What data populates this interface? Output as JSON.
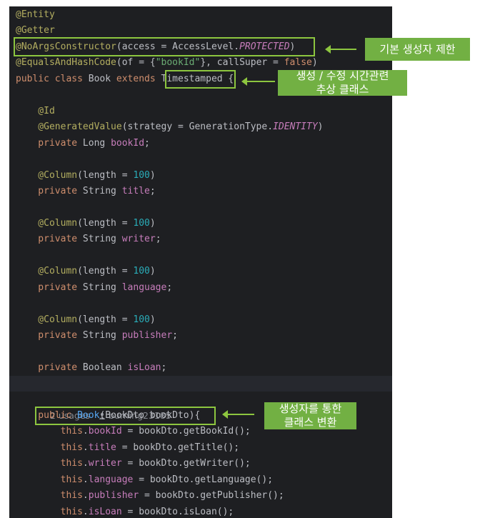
{
  "code_lines": [
    [
      {
        "t": "@Entity",
        "c": "ann"
      }
    ],
    [
      {
        "t": "@Getter",
        "c": "ann"
      }
    ],
    [
      {
        "t": "@NoArgsConstructor",
        "c": "ann"
      },
      {
        "t": "(access = AccessLevel.",
        "c": ""
      },
      {
        "t": "PROTECTED",
        "c": "cst"
      },
      {
        "t": ")",
        "c": ""
      }
    ],
    [
      {
        "t": "@EqualsAndHashCode",
        "c": "ann"
      },
      {
        "t": "(of = {",
        "c": ""
      },
      {
        "t": "\"bookId\"",
        "c": "str"
      },
      {
        "t": "}, callSuper = ",
        "c": ""
      },
      {
        "t": "false",
        "c": "kw"
      },
      {
        "t": ")",
        "c": ""
      }
    ],
    [
      {
        "t": "public class ",
        "c": "kw"
      },
      {
        "t": "Book ",
        "c": ""
      },
      {
        "t": "extends ",
        "c": "kw"
      },
      {
        "t": "Timestamped",
        "c": ""
      },
      {
        "t": " {",
        "c": ""
      }
    ],
    [],
    [
      {
        "t": "    @Id",
        "c": "ann"
      }
    ],
    [
      {
        "t": "    @GeneratedValue",
        "c": "ann"
      },
      {
        "t": "(strategy = GenerationType.",
        "c": ""
      },
      {
        "t": "IDENTITY",
        "c": "cst"
      },
      {
        "t": ")",
        "c": ""
      }
    ],
    [
      {
        "t": "    private ",
        "c": "kw"
      },
      {
        "t": "Long ",
        "c": ""
      },
      {
        "t": "bookId",
        "c": "fld"
      },
      {
        "t": ";",
        "c": ""
      }
    ],
    [],
    [
      {
        "t": "    @Column",
        "c": "ann"
      },
      {
        "t": "(length = ",
        "c": ""
      },
      {
        "t": "100",
        "c": "num"
      },
      {
        "t": ")",
        "c": ""
      }
    ],
    [
      {
        "t": "    private ",
        "c": "kw"
      },
      {
        "t": "String ",
        "c": ""
      },
      {
        "t": "title",
        "c": "fld"
      },
      {
        "t": ";",
        "c": ""
      }
    ],
    [],
    [
      {
        "t": "    @Column",
        "c": "ann"
      },
      {
        "t": "(length = ",
        "c": ""
      },
      {
        "t": "100",
        "c": "num"
      },
      {
        "t": ")",
        "c": ""
      }
    ],
    [
      {
        "t": "    private ",
        "c": "kw"
      },
      {
        "t": "String ",
        "c": ""
      },
      {
        "t": "writer",
        "c": "fld"
      },
      {
        "t": ";",
        "c": ""
      }
    ],
    [],
    [
      {
        "t": "    @Column",
        "c": "ann"
      },
      {
        "t": "(length = ",
        "c": ""
      },
      {
        "t": "100",
        "c": "num"
      },
      {
        "t": ")",
        "c": ""
      }
    ],
    [
      {
        "t": "    private ",
        "c": "kw"
      },
      {
        "t": "String ",
        "c": ""
      },
      {
        "t": "language",
        "c": "fld"
      },
      {
        "t": ";",
        "c": ""
      }
    ],
    [],
    [
      {
        "t": "    @Column",
        "c": "ann"
      },
      {
        "t": "(length = ",
        "c": ""
      },
      {
        "t": "100",
        "c": "num"
      },
      {
        "t": ")",
        "c": ""
      }
    ],
    [
      {
        "t": "    private ",
        "c": "kw"
      },
      {
        "t": "String ",
        "c": ""
      },
      {
        "t": "publisher",
        "c": "fld"
      },
      {
        "t": ";",
        "c": ""
      }
    ],
    [],
    [
      {
        "t": "    private ",
        "c": "kw"
      },
      {
        "t": "Boolean ",
        "c": ""
      },
      {
        "t": "isLoan",
        "c": "fld"
      },
      {
        "t": ";",
        "c": ""
      }
    ]
  ],
  "code_lines_2": [
    [
      {
        "t": "    public ",
        "c": "kw"
      },
      {
        "t": "Book",
        "c": "fn"
      },
      {
        "t": "(BookDto bookDto){",
        "c": ""
      }
    ],
    [
      {
        "t": "        this",
        "c": "kw"
      },
      {
        "t": ".",
        "c": ""
      },
      {
        "t": "bookId",
        "c": "fld"
      },
      {
        "t": " = bookDto.getBookId();",
        "c": ""
      }
    ],
    [
      {
        "t": "        this",
        "c": "kw"
      },
      {
        "t": ".",
        "c": ""
      },
      {
        "t": "title",
        "c": "fld"
      },
      {
        "t": " = bookDto.getTitle();",
        "c": ""
      }
    ],
    [
      {
        "t": "        this",
        "c": "kw"
      },
      {
        "t": ".",
        "c": ""
      },
      {
        "t": "writer",
        "c": "fld"
      },
      {
        "t": " = bookDto.getWriter();",
        "c": ""
      }
    ],
    [
      {
        "t": "        this",
        "c": "kw"
      },
      {
        "t": ".",
        "c": ""
      },
      {
        "t": "language",
        "c": "fld"
      },
      {
        "t": " = bookDto.getLanguage();",
        "c": ""
      }
    ],
    [
      {
        "t": "        this",
        "c": "kw"
      },
      {
        "t": ".",
        "c": ""
      },
      {
        "t": "publisher",
        "c": "fld"
      },
      {
        "t": " = bookDto.getPublisher();",
        "c": ""
      }
    ],
    [
      {
        "t": "        this",
        "c": "kw"
      },
      {
        "t": ".",
        "c": ""
      },
      {
        "t": "isLoan",
        "c": "fld"
      },
      {
        "t": " = bookDto.isLoan();",
        "c": ""
      }
    ]
  ],
  "usage_hint": {
    "usages": "2 usages",
    "author_icon": "person-icon",
    "author": "burning23185"
  },
  "annotations": {
    "noargs": "기본 생성자 제한",
    "timestamped_line1": "생성 / 수정 시간관련",
    "timestamped_line2": "추상 클래스",
    "constructor_line1": "생성자를 통한",
    "constructor_line2": "클래스 변환"
  },
  "colors": {
    "editor_bg": "#1e1f22",
    "annotation": "#b3ae60",
    "keyword": "#cf8e6d",
    "field": "#c77dbb",
    "number": "#2aacb8",
    "string": "#6aab73",
    "callout_green": "#72b043",
    "box_green": "#8dc63f"
  }
}
